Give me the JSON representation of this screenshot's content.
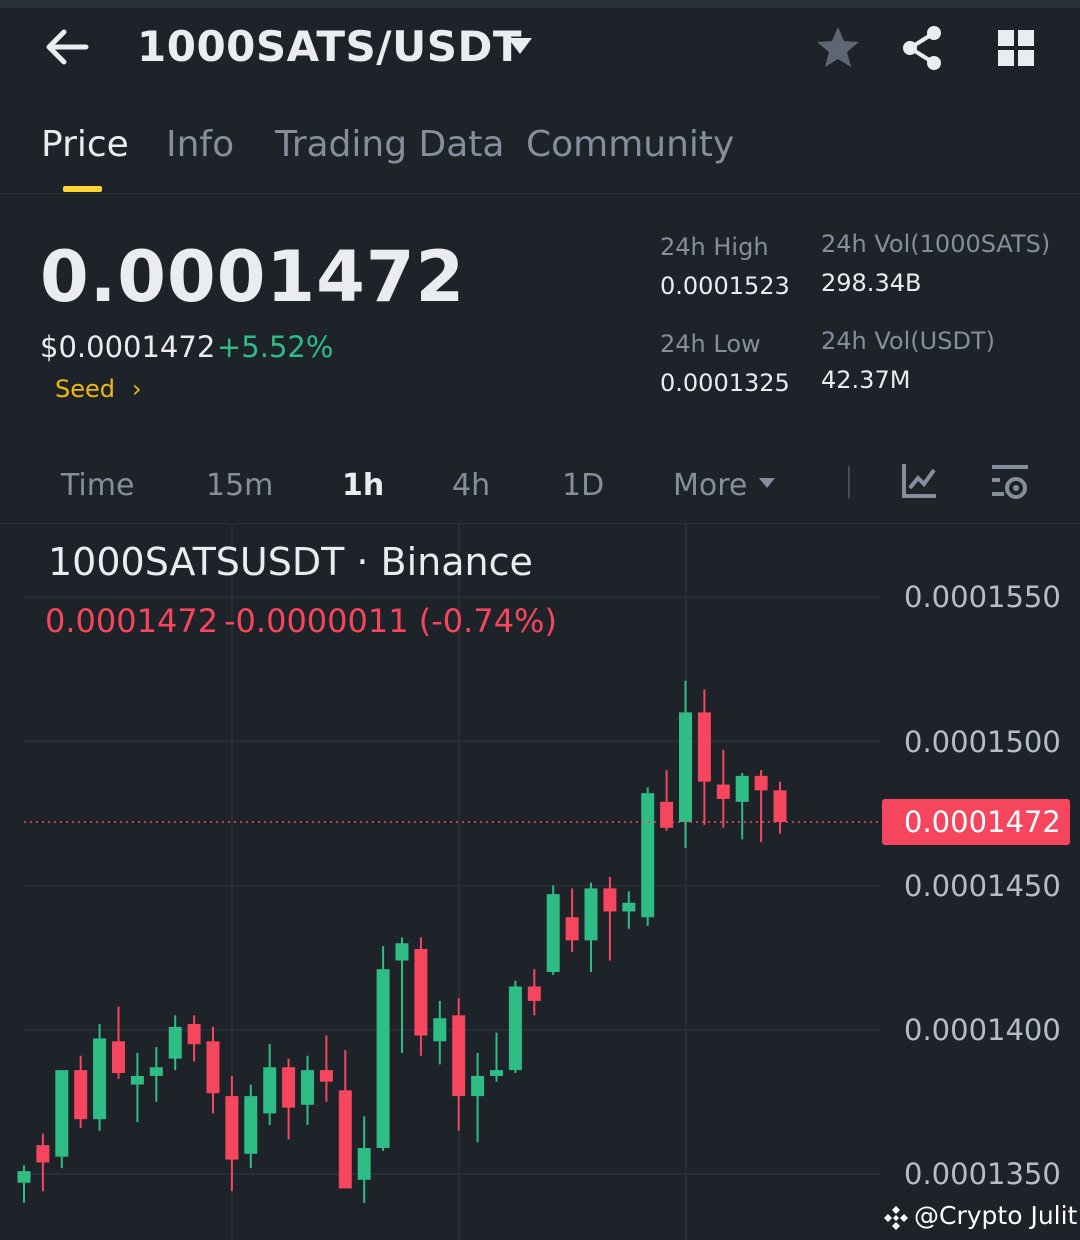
{
  "header": {
    "pair": "1000SATS/USDT",
    "icons": [
      "arrow-left-icon",
      "chevron-down-icon",
      "star-icon",
      "share-icon",
      "grid-icon"
    ]
  },
  "tabs": [
    {
      "label": "Price",
      "active": true
    },
    {
      "label": "Info",
      "active": false
    },
    {
      "label": "Trading Data",
      "active": false
    },
    {
      "label": "Community",
      "active": false
    }
  ],
  "ticker": {
    "last_price": "0.0001472",
    "fiat_price": "$0.0001472",
    "change_pct": "+5.52%",
    "tag": "Seed",
    "tag_arrow": "›",
    "stats": {
      "high_label": "24h High",
      "high_value": "0.0001523",
      "low_label": "24h Low",
      "low_value": "0.0001325",
      "vol_base_label": "24h Vol(1000SATS)",
      "vol_base_value": "298.34B",
      "vol_quote_label": "24h Vol(USDT)",
      "vol_quote_value": "42.37M"
    }
  },
  "intervals": {
    "items": [
      {
        "label": "Time",
        "active": false
      },
      {
        "label": "15m",
        "active": false
      },
      {
        "label": "1h",
        "active": true
      },
      {
        "label": "4h",
        "active": false
      },
      {
        "label": "1D",
        "active": false
      },
      {
        "label": "More",
        "active": false
      }
    ]
  },
  "chart": {
    "title": "1000SATSUSDT · Binance",
    "ohlc_close": "0.0001472",
    "change": "-0.0000011 (-0.74%)",
    "current_price_label": "0.0001472",
    "colors": {
      "up": "#2ebd85",
      "down": "#f6465d",
      "grid": "#2b3139",
      "background": "#1e2329"
    }
  },
  "chart_data": {
    "type": "candlestick",
    "title": "1000SATSUSDT · Binance",
    "ylim": [
      0.000134,
      0.0001575
    ],
    "yticks": [
      "0.0001550",
      "0.0001500",
      "0.0001450",
      "0.0001400",
      "0.0001350"
    ],
    "current_price": 0.0001472,
    "candles": [
      {
        "o": 0.0001347,
        "h": 0.0001353,
        "l": 0.000134,
        "c": 0.0001351
      },
      {
        "o": 0.000136,
        "h": 0.0001364,
        "l": 0.0001344,
        "c": 0.0001354
      },
      {
        "o": 0.0001356,
        "h": 0.0001382,
        "l": 0.0001352,
        "c": 0.0001386
      },
      {
        "o": 0.0001386,
        "h": 0.0001391,
        "l": 0.0001366,
        "c": 0.0001369
      },
      {
        "o": 0.0001369,
        "h": 0.0001402,
        "l": 0.0001365,
        "c": 0.0001397
      },
      {
        "o": 0.0001396,
        "h": 0.0001408,
        "l": 0.0001383,
        "c": 0.0001385
      },
      {
        "o": 0.0001381,
        "h": 0.0001392,
        "l": 0.0001368,
        "c": 0.0001384
      },
      {
        "o": 0.0001384,
        "h": 0.0001394,
        "l": 0.0001375,
        "c": 0.0001387
      },
      {
        "o": 0.000139,
        "h": 0.0001405,
        "l": 0.0001386,
        "c": 0.0001401
      },
      {
        "o": 0.0001402,
        "h": 0.0001405,
        "l": 0.0001389,
        "c": 0.0001395
      },
      {
        "o": 0.0001396,
        "h": 0.0001401,
        "l": 0.0001371,
        "c": 0.0001378
      },
      {
        "o": 0.0001377,
        "h": 0.0001384,
        "l": 0.0001344,
        "c": 0.0001355
      },
      {
        "o": 0.0001357,
        "h": 0.0001381,
        "l": 0.0001352,
        "c": 0.0001377
      },
      {
        "o": 0.0001371,
        "h": 0.0001395,
        "l": 0.0001367,
        "c": 0.0001387
      },
      {
        "o": 0.0001387,
        "h": 0.000139,
        "l": 0.0001362,
        "c": 0.0001373
      },
      {
        "o": 0.0001374,
        "h": 0.0001391,
        "l": 0.0001367,
        "c": 0.0001386
      },
      {
        "o": 0.0001386,
        "h": 0.0001398,
        "l": 0.0001375,
        "c": 0.0001382
      },
      {
        "o": 0.0001379,
        "h": 0.0001393,
        "l": 0.0001348,
        "c": 0.0001345
      },
      {
        "o": 0.0001348,
        "h": 0.000137,
        "l": 0.000134,
        "c": 0.0001359
      },
      {
        "o": 0.0001359,
        "h": 0.0001429,
        "l": 0.0001358,
        "c": 0.0001421
      },
      {
        "o": 0.0001424,
        "h": 0.0001432,
        "l": 0.0001392,
        "c": 0.000143
      },
      {
        "o": 0.0001428,
        "h": 0.0001432,
        "l": 0.0001391,
        "c": 0.0001398
      },
      {
        "o": 0.0001396,
        "h": 0.000141,
        "l": 0.0001388,
        "c": 0.0001404
      },
      {
        "o": 0.0001405,
        "h": 0.0001411,
        "l": 0.0001365,
        "c": 0.0001377
      },
      {
        "o": 0.0001377,
        "h": 0.0001392,
        "l": 0.0001361,
        "c": 0.0001384
      },
      {
        "o": 0.0001384,
        "h": 0.0001399,
        "l": 0.0001382,
        "c": 0.0001386
      },
      {
        "o": 0.0001386,
        "h": 0.0001417,
        "l": 0.0001385,
        "c": 0.0001415
      },
      {
        "o": 0.0001415,
        "h": 0.0001421,
        "l": 0.0001405,
        "c": 0.000141
      },
      {
        "o": 0.000142,
        "h": 0.000145,
        "l": 0.0001419,
        "c": 0.0001447
      },
      {
        "o": 0.0001439,
        "h": 0.0001449,
        "l": 0.0001427,
        "c": 0.0001431
      },
      {
        "o": 0.0001431,
        "h": 0.0001451,
        "l": 0.000142,
        "c": 0.0001449
      },
      {
        "o": 0.0001449,
        "h": 0.0001453,
        "l": 0.0001424,
        "c": 0.0001441
      },
      {
        "o": 0.0001441,
        "h": 0.0001448,
        "l": 0.0001435,
        "c": 0.0001444
      },
      {
        "o": 0.0001439,
        "h": 0.0001484,
        "l": 0.0001436,
        "c": 0.0001482
      },
      {
        "o": 0.0001479,
        "h": 0.000149,
        "l": 0.0001469,
        "c": 0.000147
      },
      {
        "o": 0.0001472,
        "h": 0.0001521,
        "l": 0.0001463,
        "c": 0.000151
      },
      {
        "o": 0.000151,
        "h": 0.0001518,
        "l": 0.0001471,
        "c": 0.0001486
      },
      {
        "o": 0.0001485,
        "h": 0.0001497,
        "l": 0.000147,
        "c": 0.000148
      },
      {
        "o": 0.0001479,
        "h": 0.0001489,
        "l": 0.0001466,
        "c": 0.0001488
      },
      {
        "o": 0.0001488,
        "h": 0.000149,
        "l": 0.0001465,
        "c": 0.0001483
      },
      {
        "o": 0.0001483,
        "h": 0.0001486,
        "l": 0.0001468,
        "c": 0.0001472
      }
    ]
  },
  "watermark": {
    "text": "@Crypto Julit"
  }
}
